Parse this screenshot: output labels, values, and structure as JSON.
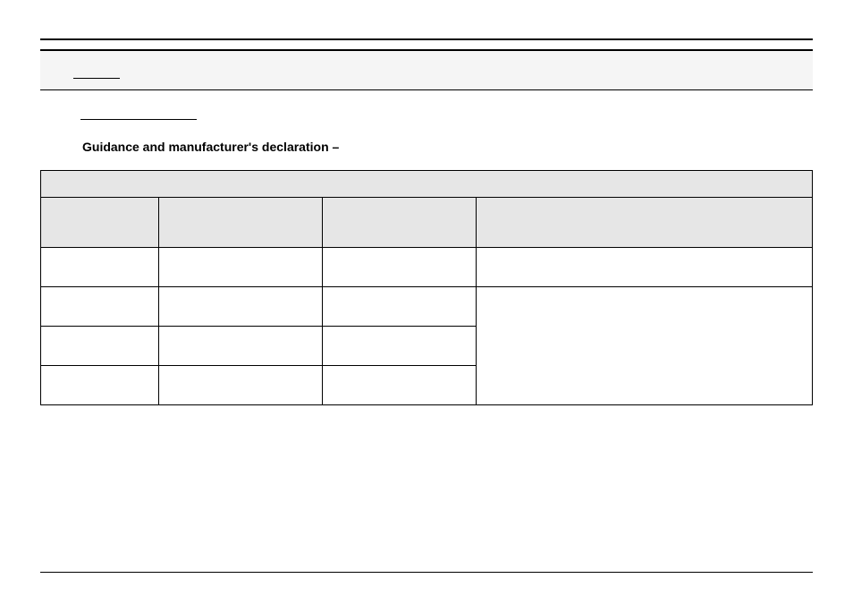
{
  "heading": "Guidance and manufacturer's declaration –",
  "table": {
    "top_banner": "",
    "headers": [
      "",
      "",
      "",
      ""
    ],
    "rows": [
      {
        "cells": [
          "",
          "",
          "",
          ""
        ]
      },
      {
        "cells": [
          "",
          "",
          ""
        ],
        "merged_right": ""
      },
      {
        "cells": [
          "",
          "",
          ""
        ]
      },
      {
        "cells": [
          "",
          "",
          ""
        ]
      }
    ]
  }
}
